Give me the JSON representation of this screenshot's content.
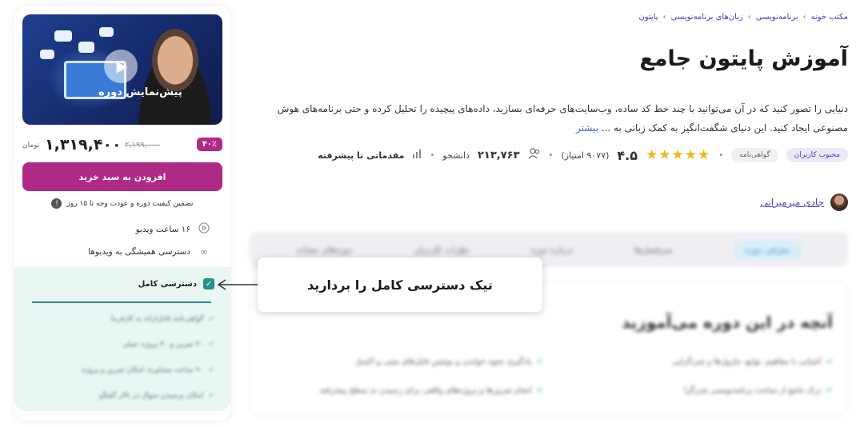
{
  "breadcrumb": [
    "مکتب خونه",
    "برنامه‌نویسی",
    "زبان‌های برنامه‌نویسی",
    "پایتون"
  ],
  "breadcrumb_sep": "›",
  "course": {
    "title": "آموزش پایتون جامع",
    "description": "دنیایی را تصور کنید که در آن می‌توانید با چند خط کد ساده، وب‌سایت‌های حرفه‌ای بسازید، داده‌های پیچیده را تحلیل کرده و حتی برنامه‌های هوش مصنوعی ایجاد کنید. این دنیای شگفت‌انگیز به کمک زبانی به ...",
    "more_link": "بیشتر"
  },
  "stats": {
    "badge_popular": "محبوب کاربران",
    "badge_certificate": "گواهی‌نامه",
    "rating": "۴.۵",
    "rating_count": "(۹۰۷۷ امتیاز)",
    "students": "۲۱۳,۷۶۳",
    "students_label": "دانشجو",
    "level": "مقدماتی تا پیشرفته",
    "stars": "★★★★★"
  },
  "instructor": {
    "name": "جادی میرمیرانی"
  },
  "tabs": [
    "معرفی دوره",
    "سرفصل‌ها",
    "درباره دوره",
    "نظرات کاربران",
    "دوره‌های مشابه"
  ],
  "learn": {
    "title": "آنچه در این دوره می‌آموزید",
    "items": [
      "آشنایی با مفاهیم، توابع، ماژول‌ها و شی‌گرایی",
      "یادگیری نحوه خواندن و نوشتن فایل‌های متنی و اکسل",
      "درک جامع از مباحث برنامه‌نویسی شی‌گرا",
      "انجام تمرین‌ها و پروژه‌های واقعی برای رسیدن به سطح پیشرفته"
    ]
  },
  "sidebar": {
    "preview_label": "پیش‌نمایش دوره",
    "discount": "۴۰٪",
    "old_price": "۲,۱۹۹,۰۰۰",
    "price": "۱,۳۱۹,۴۰۰",
    "currency": "تومان",
    "cart_button": "افزودن به سبد خرید",
    "guarantee": "تضمین کیفیت دوره و عودت وجه تا ۱۵ روز",
    "features": [
      {
        "icon": "play-circle-icon",
        "glyph": "▷",
        "label": "۱۶ ساعت ویدیو"
      },
      {
        "icon": "infinity-icon",
        "glyph": "∞",
        "label": "دسترسی همیشگی به ویدیوها"
      }
    ],
    "full_access": {
      "label": "دسترسی کامل",
      "items": [
        "گواهی‌نامه قابل‌ارائه به کارفرما",
        "۳۰ تمرین و ۴۰ پروژه عملی",
        "۹۰ ساعت مشاوره، امکان تمرین و پروژه",
        "امکان پرسیدن سوال در تالار گفتگو"
      ]
    }
  },
  "callout": {
    "text": "تیک دسترسی کامل را بردارید"
  },
  "colors": {
    "accent": "#ae2a86",
    "primary": "#4a3cc9",
    "teal": "#2a8f8a",
    "star": "#f4b614"
  }
}
